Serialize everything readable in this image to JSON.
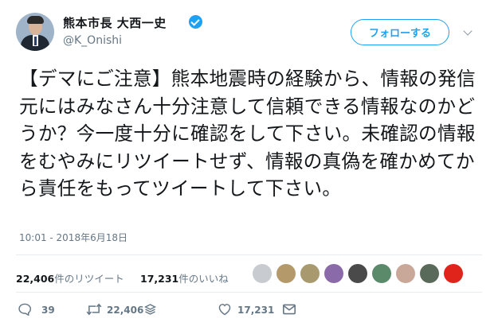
{
  "user": {
    "display_name": "熊本市長 大西一史",
    "handle": "@K_Onishi",
    "verified": true
  },
  "follow_button_label": "フォローする",
  "tweet": {
    "text": "【デマにご注意】熊本地震時の経験から、情報の発信元にはみなさん十分注意して信頼できる情報なのかどうか？今一度十分に確認をして下さい。未確認の情報をむやみにリツイートせず、情報の真偽を確かめてから責任をもってツイートして下さい。",
    "timestamp": "10:01 - 2018年6月18日"
  },
  "stats": {
    "retweets_count": "22,406",
    "retweets_label": "件のリツイート",
    "likes_count": "17,231",
    "likes_label": "件のいいね"
  },
  "liker_avatars": [
    {
      "color": "#c8ccd0"
    },
    {
      "color": "#b49a6a"
    },
    {
      "color": "#a89a6e"
    },
    {
      "color": "#8a6aa8"
    },
    {
      "color": "#4a4a4a"
    },
    {
      "color": "#5a8a6a"
    },
    {
      "color": "#c9a89a"
    },
    {
      "color": "#5a6a5a"
    },
    {
      "color": "#e0241b"
    }
  ],
  "actions": {
    "reply_count": "39",
    "retweet_count": "22,406",
    "like_count": "17,231"
  },
  "colors": {
    "accent": "#1da1f2",
    "text": "#14171a",
    "muted": "#657786",
    "divider": "#e6ecf0"
  },
  "icons": [
    "verified-badge-icon",
    "chevron-down-icon",
    "reply-icon",
    "retweet-icon",
    "stack-icon",
    "heart-icon",
    "direct-message-icon"
  ]
}
